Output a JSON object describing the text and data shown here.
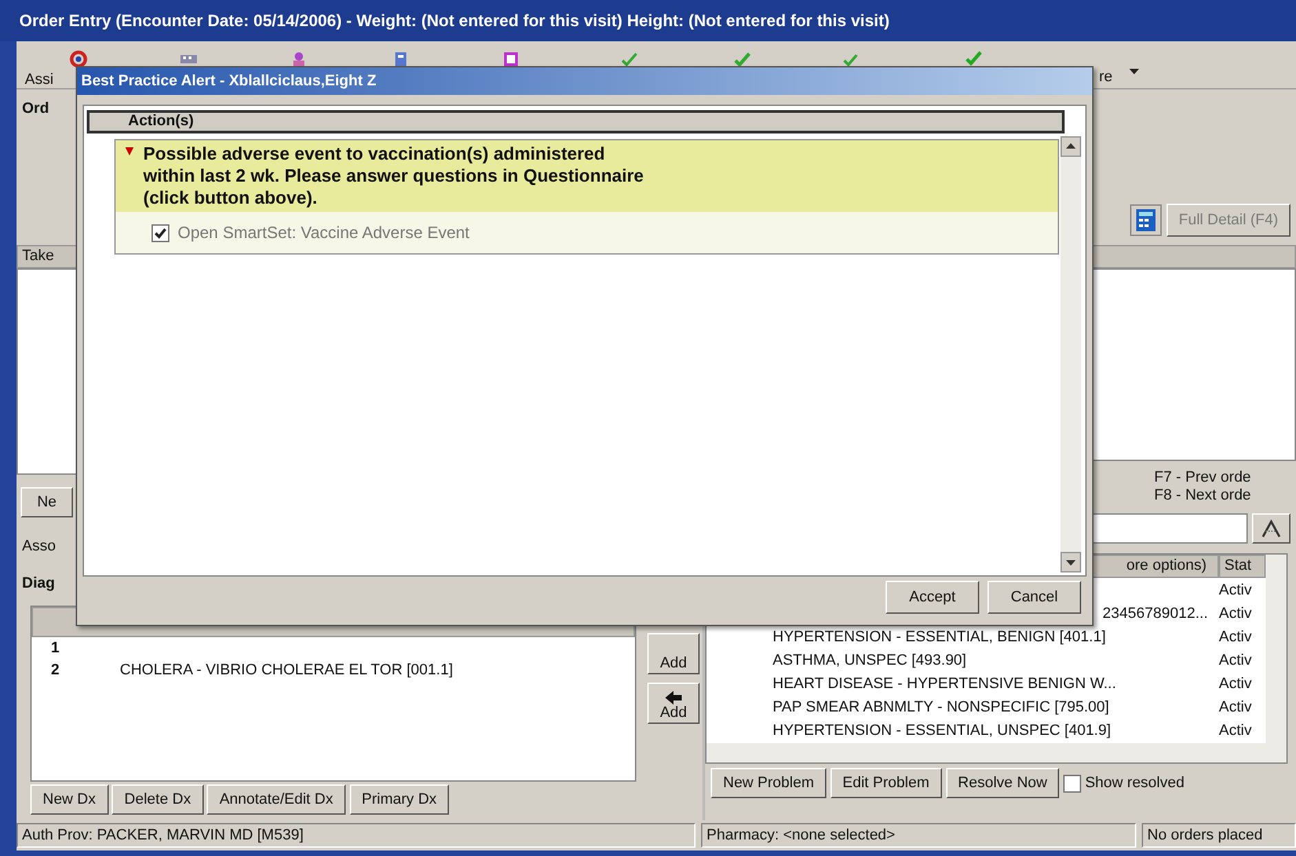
{
  "window": {
    "title": "Order Entry (Encounter Date: 05/14/2006) - Weight: (Not entered for this visit) Height: (Not entered for this visit)"
  },
  "toolbar": {
    "label_left": "Assi",
    "label_right": "re"
  },
  "orders": {
    "label": "Ord",
    "list_header": "Take",
    "new_button": "Ne",
    "full_detail_button": {
      "label": "Full Detail (F4)",
      "disabled": true
    },
    "hints": [
      "F7 - Prev orde",
      "F8 - Next orde"
    ]
  },
  "associate": {
    "label": "Asso"
  },
  "diagnoses": {
    "label": "Diag",
    "rows": [
      {
        "number": "1"
      },
      {
        "number": "2",
        "description": "CHOLERA - VIBRIO CHOLERAE EL TOR [001.1]"
      }
    ],
    "buttons": [
      "New Dx",
      "Delete Dx",
      "Annotate/Edit Dx",
      "Primary Dx"
    ]
  },
  "add_buttons": [
    {
      "label": "Add",
      "arrow": false
    },
    {
      "label": "Add",
      "arrow": true
    }
  ],
  "problems": {
    "columns": [
      "ore options)",
      "Stat"
    ],
    "rows": [
      {
        "status": "Activ"
      },
      {
        "description": "23456789012...",
        "cut_left": true,
        "status": "Activ"
      },
      {
        "description": "HYPERTENSION - ESSENTIAL, BENIGN [401.1]",
        "cut_left": false,
        "status": "Activ"
      },
      {
        "description": "ASTHMA, UNSPEC [493.90]",
        "cut_left": false,
        "status": "Activ"
      },
      {
        "description": "HEART DISEASE - HYPERTENSIVE BENIGN W...",
        "cut_left": false,
        "status": "Activ"
      },
      {
        "description": "PAP SMEAR ABNMLTY - NONSPECIFIC [795.00]",
        "cut_left": false,
        "status": "Activ"
      },
      {
        "description": "HYPERTENSION - ESSENTIAL, UNSPEC [401.9]",
        "cut_left": false,
        "status": "Activ"
      }
    ],
    "buttons": [
      "New Problem",
      "Edit Problem",
      "Resolve Now"
    ],
    "show_resolved": {
      "label": "Show resolved",
      "checked": false
    }
  },
  "status_bar": [
    "Auth Prov: PACKER, MARVIN MD [M539]",
    "Pharmacy: <none selected>",
    "No orders placed"
  ],
  "dialog": {
    "title": "Best Practice Alert  - Xblallciclaus,Eight Z",
    "header": "Action(s)",
    "alert": {
      "text": "Possible adverse event to vaccination(s) administered\nwithin last 2 wk. Please answer questions in Questionnaire\n(click button above).",
      "option": {
        "label": "Open SmartSet: Vaccine Adverse Event",
        "checked": true
      }
    },
    "buttons": [
      "Accept",
      "Cancel"
    ]
  }
}
